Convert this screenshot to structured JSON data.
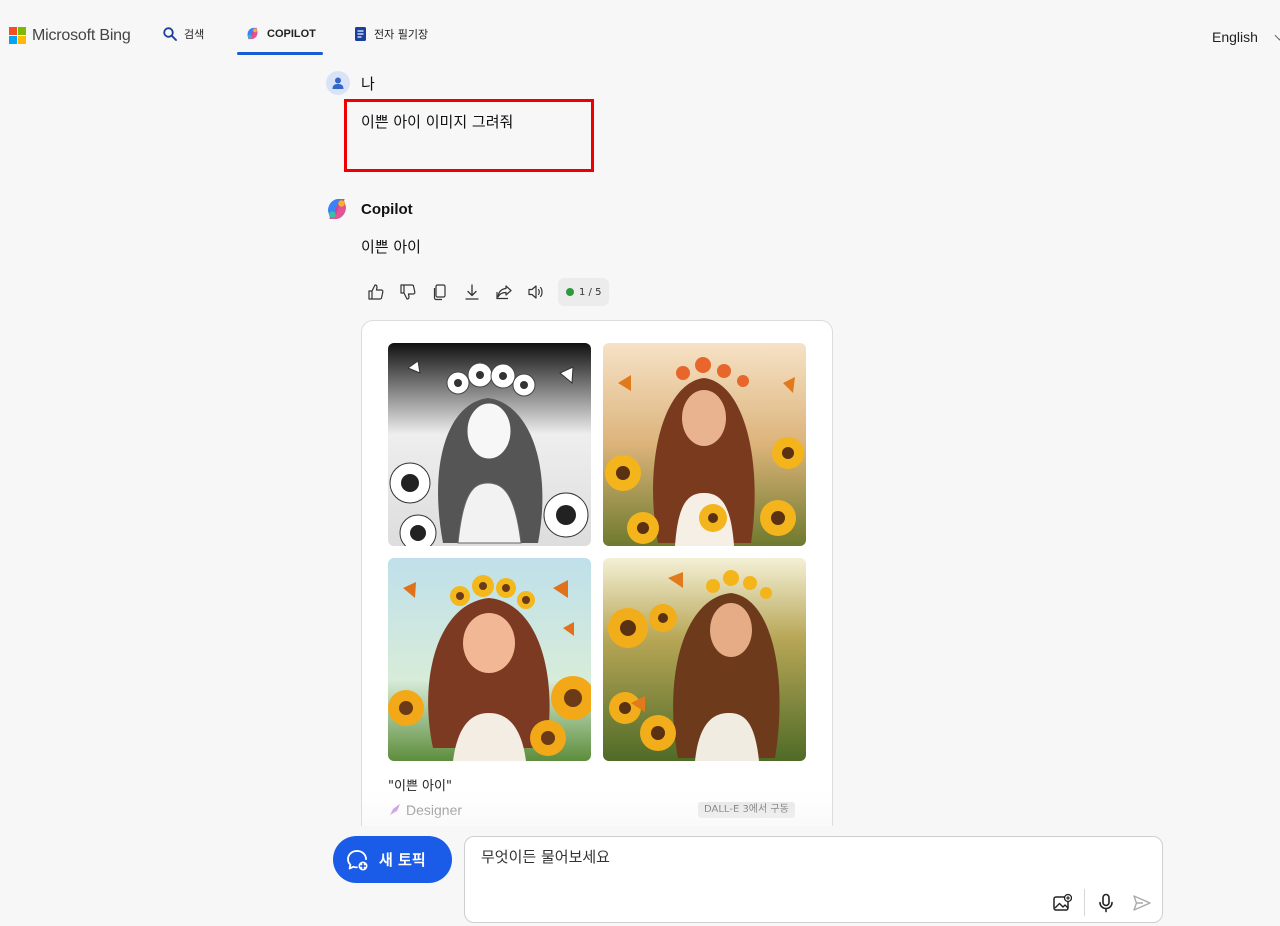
{
  "header": {
    "brand": "Microsoft Bing",
    "nav": {
      "search_label": "검색",
      "copilot_label": "COPILOT",
      "notebook_label": "전자 필기장"
    },
    "language": "English"
  },
  "user_message": {
    "author": "나",
    "text": "이쁜 아이 이미지 그려줘"
  },
  "copilot_message": {
    "author": "Copilot",
    "text": "이쁜 아이",
    "response_counter": "1 / 5",
    "actions": [
      "thumbs-up-icon",
      "thumbs-down-icon",
      "copy-icon",
      "download-icon",
      "share-icon",
      "speaker-icon"
    ]
  },
  "image_card": {
    "caption": "\"이쁜 아이\"",
    "designer_label": "Designer",
    "dalle_badge": "DALL-E 3에서 구동",
    "images": [
      "sunflower-girl-sketch",
      "sunflower-girl-photo",
      "sunflower-girl-cartoon",
      "sunflower-girl-portrait"
    ]
  },
  "composer": {
    "new_topic_label": "새 토픽",
    "placeholder": "무엇이든 물어보세요"
  },
  "colors": {
    "accent": "#1a5be8",
    "highlight_box": "#ee0000",
    "background": "#f7f7f7"
  }
}
